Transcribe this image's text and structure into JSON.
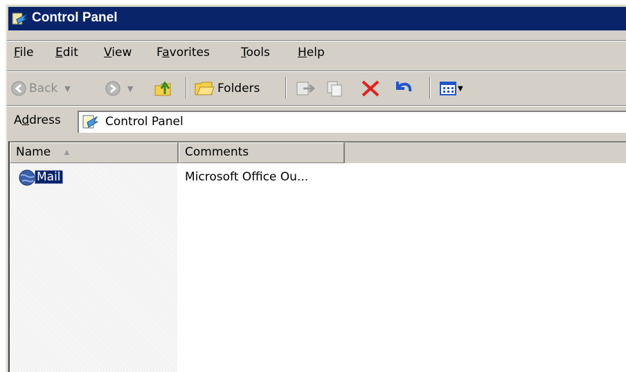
{
  "window": {
    "title": "Control Panel",
    "title_bar_color": "#0a246a",
    "chrome_color": "#d4d0c8"
  },
  "menu": {
    "items": [
      {
        "label": "File",
        "accel": "F",
        "rest": "ile"
      },
      {
        "label": "Edit",
        "accel": "E",
        "rest": "dit"
      },
      {
        "label": "View",
        "accel": "V",
        "rest": "iew"
      },
      {
        "label": "Favorites",
        "pre": "F",
        "accel": "a",
        "rest": "vorites"
      },
      {
        "label": "Tools",
        "accel": "T",
        "rest": "ools"
      },
      {
        "label": "Help",
        "accel": "H",
        "rest": "elp"
      }
    ]
  },
  "toolbar": {
    "back_label": "Back",
    "folders_label": "Folders",
    "icons": [
      "back-arrow-icon",
      "forward-arrow-icon",
      "up-folder-icon",
      "folders-icon",
      "move-to-icon",
      "copy-to-icon",
      "delete-icon",
      "undo-icon",
      "views-icon"
    ]
  },
  "address": {
    "label": "Address",
    "label_pre": "A",
    "label_accel": "d",
    "label_rest": "dress",
    "value": "Control Panel"
  },
  "list": {
    "columns": [
      "Name",
      "Comments"
    ],
    "sort_indicator": "ascending",
    "rows": [
      {
        "name": "Mail",
        "comments": "Microsoft Office Ou...",
        "selected": true,
        "icon": "mail-globe-icon"
      }
    ],
    "selection_color": "#0a246a"
  }
}
